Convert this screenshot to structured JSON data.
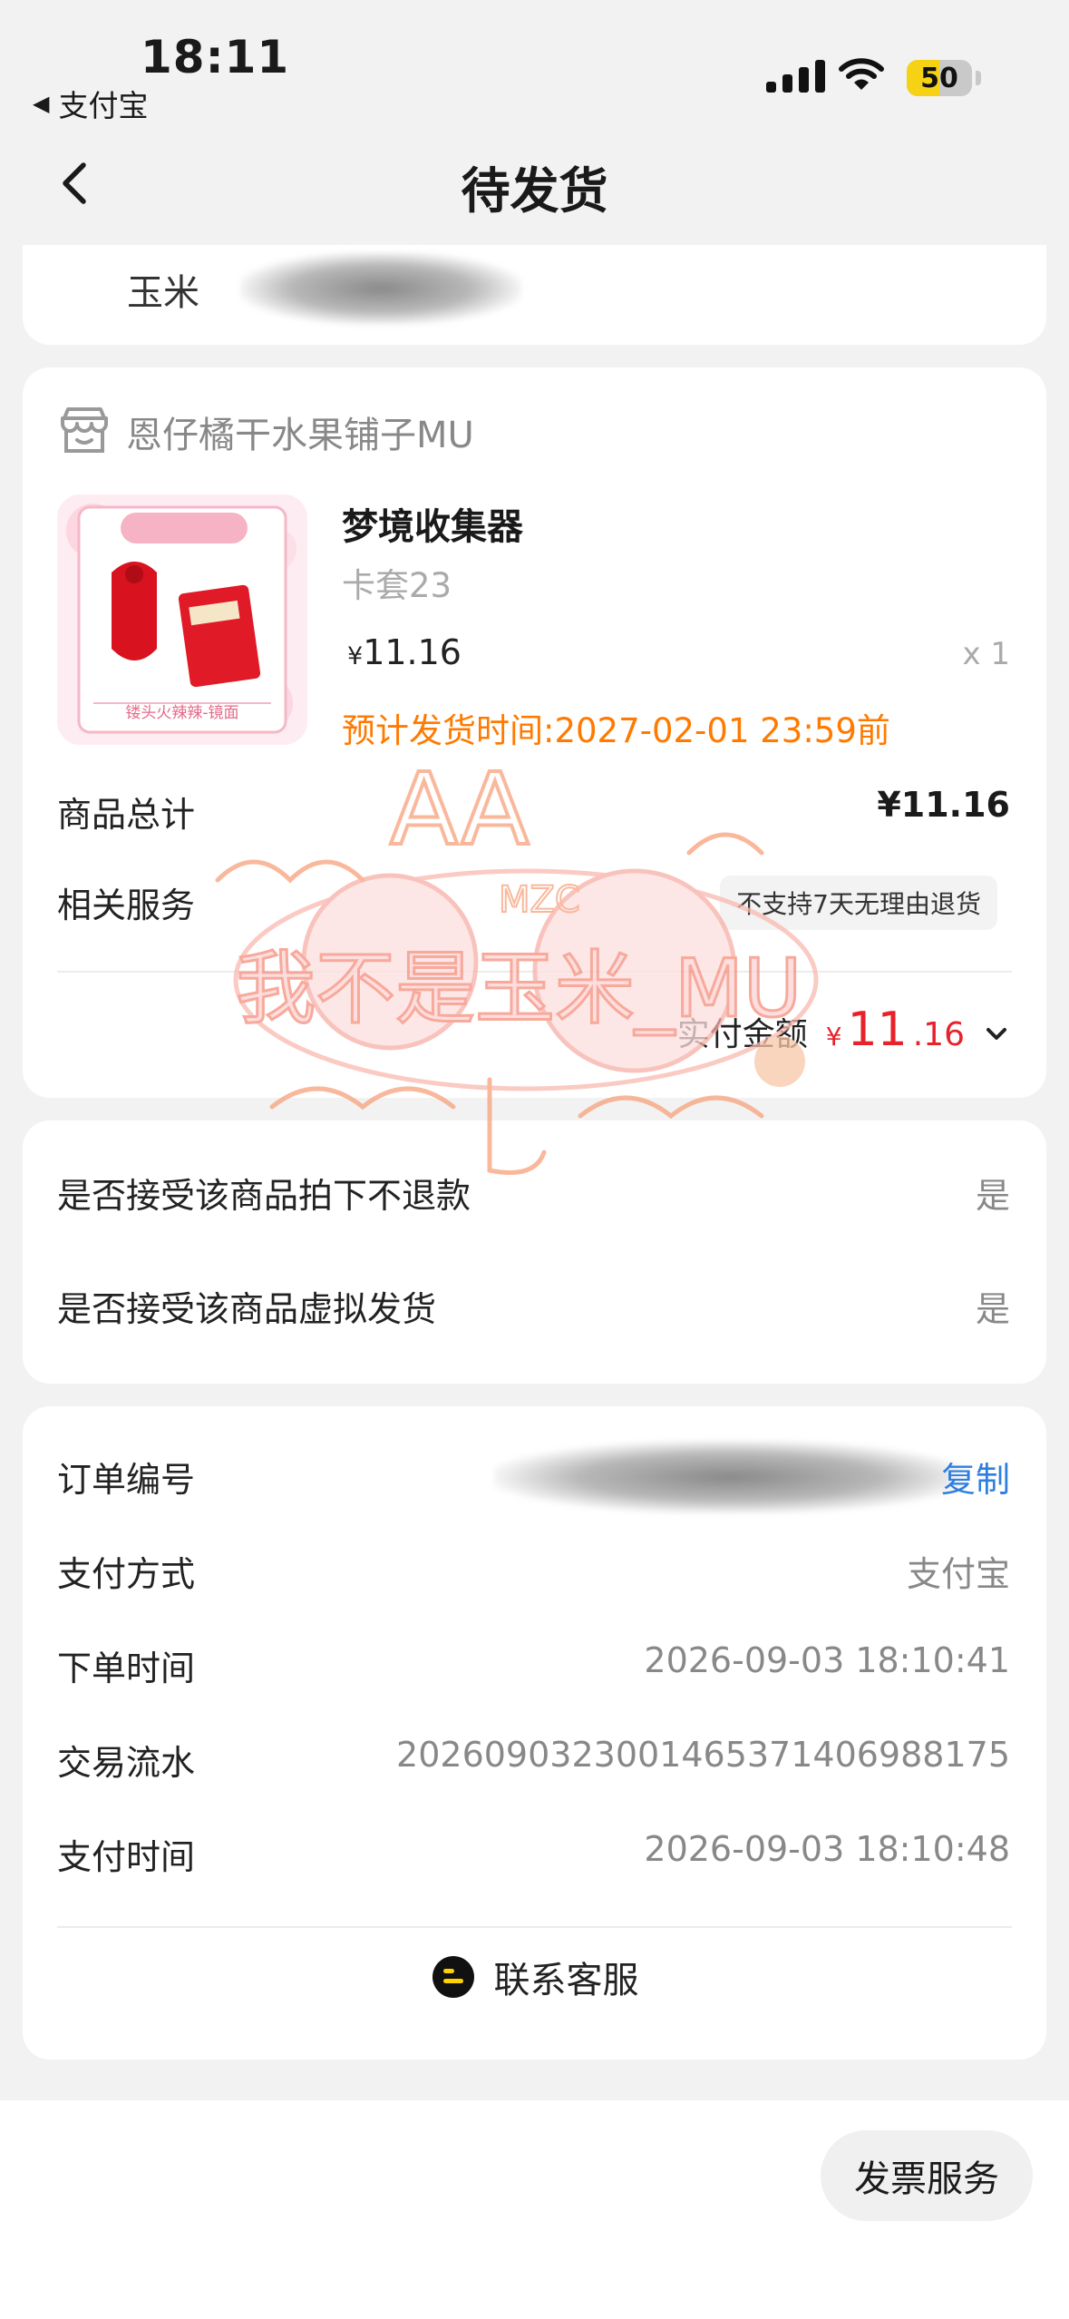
{
  "status_bar": {
    "time": "18:11",
    "back_app": "支付宝",
    "battery": "50",
    "battery_level": 0.5
  },
  "nav": {
    "title": "待发货"
  },
  "address": {
    "name": "玉米"
  },
  "shop": {
    "name": "恩仔橘干水果铺子MU",
    "product_image_caption": "镂头火辣辣-镜面"
  },
  "product": {
    "name": "梦境收集器",
    "variant": "卡套23",
    "currency": "¥",
    "price": "11.16",
    "qty": "x 1",
    "ship_estimate": "预计发货时间:2027-02-01 23:59前"
  },
  "summary": {
    "total_label": "商品总计",
    "total_value": "¥11.16",
    "service_label": "相关服务",
    "service_badge": "不支持7天无理由退货",
    "paid_label": "实付金额",
    "paid_currency": "¥",
    "paid_int": "11",
    "paid_dec": ".16"
  },
  "agreements": [
    {
      "label": "是否接受该商品拍下不退款",
      "value": "是"
    },
    {
      "label": "是否接受该商品虚拟发货",
      "value": "是"
    }
  ],
  "order_info": {
    "order_no_label": "订单编号",
    "copy_label": "复制",
    "pay_method_label": "支付方式",
    "pay_method_value": "支付宝",
    "order_time_label": "下单时间",
    "order_time_value": "2026-09-03 18:10:41",
    "trade_no_label": "交易流水",
    "trade_no_value": "2026090323001465371406988175",
    "pay_time_label": "支付时间",
    "pay_time_value": "2026-09-03 18:10:48",
    "contact_label": "联系客服"
  },
  "footer": {
    "invoice_label": "发票服务"
  },
  "watermark": {
    "line1": "AA",
    "line2": "MZC",
    "line3": "我不是玉米_MU"
  },
  "colors": {
    "accent_red": "#e8222b",
    "accent_orange": "#ff7a00",
    "link_blue": "#2f7fe0"
  }
}
